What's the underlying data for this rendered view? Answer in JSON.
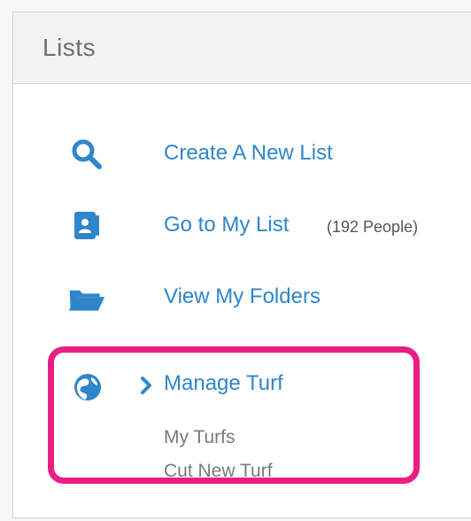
{
  "panel": {
    "title": "Lists"
  },
  "menu": {
    "items": [
      {
        "label": "Create A New List",
        "icon": "search-icon"
      },
      {
        "label": "Go to My List",
        "count": "(192 People)",
        "icon": "contact-card-icon"
      },
      {
        "label": "View My Folders",
        "icon": "folder-open-icon"
      }
    ],
    "turf": {
      "label": "Manage Turf",
      "icon": "globe-icon",
      "chevron_icon": "chevron-right-icon",
      "subitems": [
        "My Turfs",
        "Cut New Turf"
      ]
    }
  },
  "colors": {
    "link": "#2f86c9",
    "highlight": "#e91e83",
    "header_bg": "#f2f2f2"
  }
}
